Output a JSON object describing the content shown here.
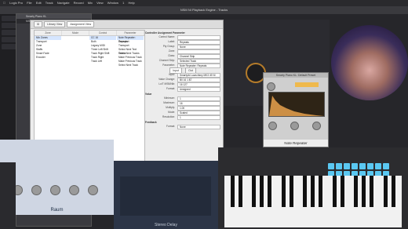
{
  "menubar": {
    "items": [
      "Logic Pro",
      "File",
      "Edit",
      "Track",
      "Navigate",
      "Record",
      "Mix",
      "View",
      "Window",
      "1",
      "Help"
    ],
    "project_title": "NSM NI Playback Engine - Tracks"
  },
  "controller_window": {
    "title": "Smarty Piano KL",
    "subtitle": "MIDI Di Plugin Smarty/tasks 1"
  },
  "main_panel": {
    "tabs": [
      "Library View",
      "Assignment View"
    ],
    "columns": [
      "Zone",
      "Mode",
      "Control",
      "Parameter"
    ],
    "zone_items": [
      "Mix Zones",
      "Transport",
      "Zone",
      "Staffs",
      "Smart Fade",
      "Encoder"
    ],
    "mode_items": [],
    "control_items": [
      "CC 16",
      "Both",
      "Legacy MIDI",
      "Three Left Shift",
      "Track Right Shift",
      "Track Right",
      "Track Left"
    ],
    "parameter_items": [
      "Note Repeater: Repeats",
      "Transport",
      "Transport",
      "Select Next Text Tracks",
      "Select Next Tracks",
      "Make Previous Track",
      "Make Previous Track",
      "Select Next Track"
    ],
    "param_section_title": "Controller Assignment Parameter",
    "params": [
      {
        "label": "Control Name:",
        "value": ""
      },
      {
        "label": "Label:",
        "value": "Repeats"
      },
      {
        "label": "Pty Group:",
        "value": "None"
      },
      {
        "label": "Zone:",
        "value": ""
      },
      {
        "label": "Class:",
        "value": "Channel Strip"
      },
      {
        "label": "Channel Strip:",
        "value": "Selected Track"
      },
      {
        "label": "Parameter:",
        "value": "Note Repeater: Repeats"
      }
    ],
    "io_tabs": [
      "Input",
      "Out"
    ],
    "input_params": [
      {
        "label": "Input:",
        "value": "Smarty/kl  Launchkey MK3 49 NI Out"
      },
      {
        "label": "Value Change:",
        "value": "B0 16 1 $7"
      },
      {
        "label": "Lo/T MSB/Nib:",
        "value": "16    127"
      },
      {
        "label": "Format:",
        "value": "Unsigned"
      }
    ],
    "value_section_title": "Value",
    "value_params": [
      {
        "label": "Minimum:",
        "value": "1"
      },
      {
        "label": "Maximum:",
        "value": "16"
      },
      {
        "label": "Multiply:",
        "value": "1.00"
      },
      {
        "label": "Mode:",
        "value": "Scaled"
      },
      {
        "label": "Resolution:",
        "value": "1"
      }
    ],
    "feedback_section_title": "Feedback",
    "feedback_params": [
      {
        "label": "Format:",
        "value": "None"
      }
    ]
  },
  "synth_window": {
    "title": "Smarty Piano KL: Default Preset",
    "footer": "Note Repeater"
  },
  "plugin_mid": {
    "value_label": "Note Distance",
    "percent": "33 %"
  },
  "raum": {
    "label": "Raum"
  },
  "stereo_delay": {
    "label": "Stereo Delay"
  }
}
